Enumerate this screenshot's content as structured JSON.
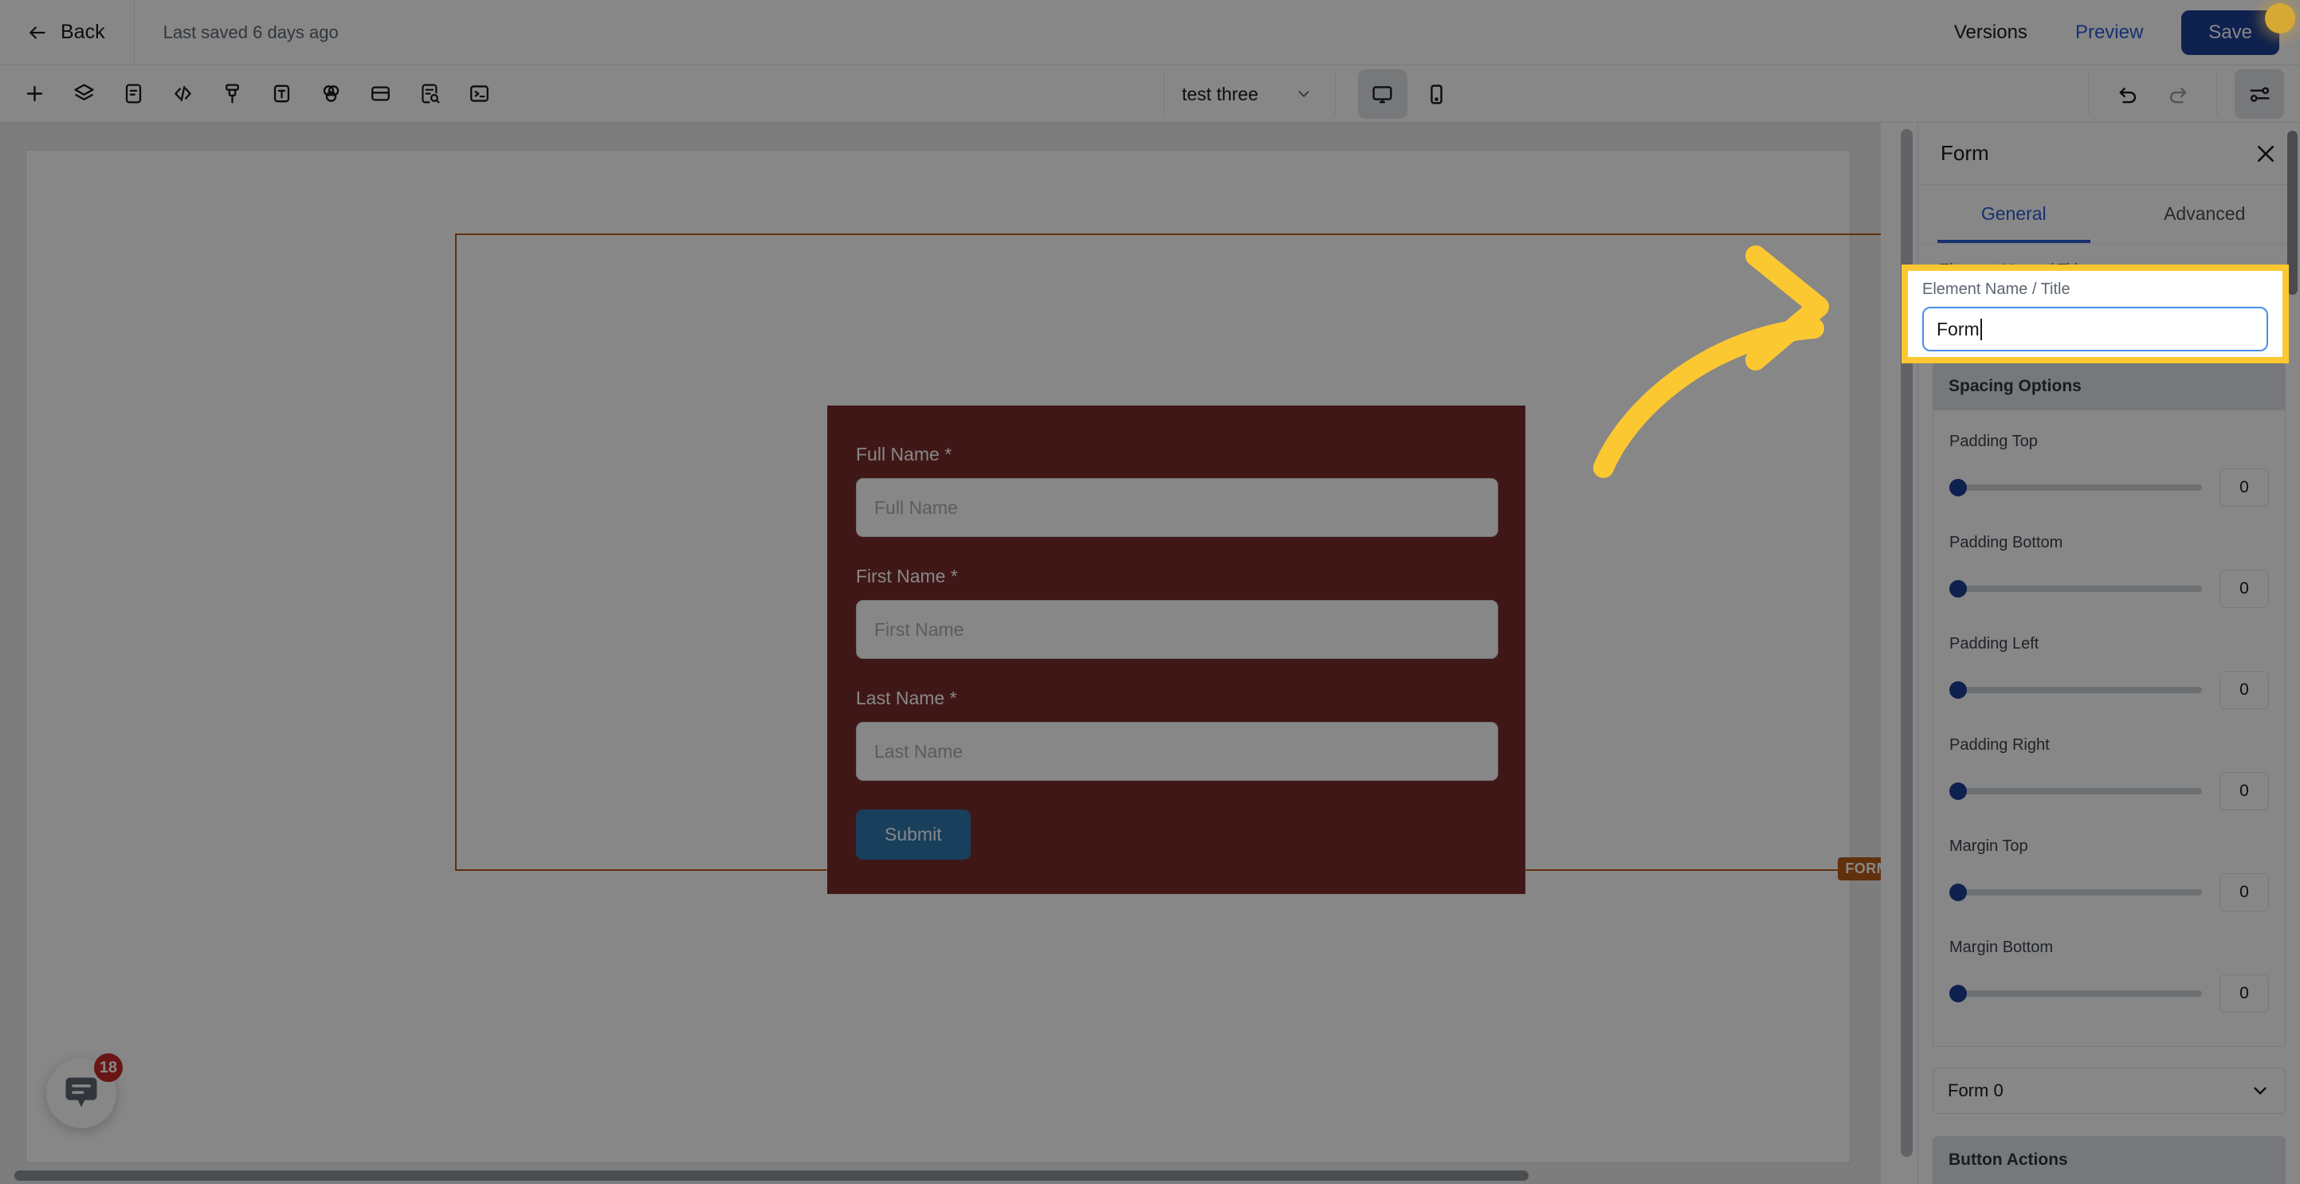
{
  "header": {
    "back_label": "Back",
    "saved_status": "Last saved 6 days ago",
    "versions_label": "Versions",
    "preview_label": "Preview",
    "save_label": "Save",
    "accent_color": "#1e3f96",
    "link_color": "#2a5bd7",
    "notification_dot_color": "#d6a935"
  },
  "toolbar": {
    "icons": [
      {
        "name": "add-icon",
        "title": "Add"
      },
      {
        "name": "layers-icon",
        "title": "Layers"
      },
      {
        "name": "document-icon",
        "title": "Content"
      },
      {
        "name": "code-icon",
        "title": "Code"
      },
      {
        "name": "brush-icon",
        "title": "Style"
      },
      {
        "name": "text-icon",
        "title": "Text"
      },
      {
        "name": "color-blend-icon",
        "title": "Colors"
      },
      {
        "name": "card-icon",
        "title": "Card"
      },
      {
        "name": "document-search-icon",
        "title": "Inspect"
      },
      {
        "name": "terminal-icon",
        "title": "Console"
      }
    ],
    "page_selector": "test three",
    "desktop_view_label": "Desktop",
    "mobile_view_label": "Mobile",
    "undo_label": "Undo",
    "redo_label": "Redo",
    "settings_label": "Settings"
  },
  "canvas": {
    "selection_badge": "FORM",
    "selection_outline_color": "#b85c17",
    "form": {
      "background_color": "#7a2d2d",
      "fields": [
        {
          "label": "Full Name *",
          "placeholder": "Full Name",
          "value": ""
        },
        {
          "label": "First Name *",
          "placeholder": "First Name",
          "value": ""
        },
        {
          "label": "Last Name *",
          "placeholder": "Last Name",
          "value": ""
        }
      ],
      "submit_label": "Submit",
      "submit_color": "#2f78ad"
    },
    "chat_widget": {
      "badge_count": "18",
      "badge_color": "#c62828"
    }
  },
  "panel": {
    "title": "Form",
    "close_label": "Close",
    "tabs": [
      {
        "label": "General",
        "active": true
      },
      {
        "label": "Advanced",
        "active": false
      }
    ],
    "element_name": {
      "label": "Element Name / Title",
      "value": "Form",
      "placeholder": "Element Name / Title"
    },
    "spacing_section": {
      "title": "Spacing Options",
      "rows": [
        {
          "label": "Padding Top",
          "value": "0",
          "slider_pct": 0
        },
        {
          "label": "Padding Bottom",
          "value": "0",
          "slider_pct": 0
        },
        {
          "label": "Padding Left",
          "value": "0",
          "slider_pct": 0
        },
        {
          "label": "Padding Right",
          "value": "0",
          "slider_pct": 0
        },
        {
          "label": "Margin Top",
          "value": "0",
          "slider_pct": 0
        },
        {
          "label": "Margin Bottom",
          "value": "0",
          "slider_pct": 0
        }
      ]
    },
    "form_select": {
      "value": "Form 0"
    },
    "button_actions_section": {
      "title": "Button Actions"
    }
  },
  "annotation": {
    "highlight_color": "#fcc832",
    "arrow_color": "#fcc832",
    "arrow_direction": "right"
  }
}
